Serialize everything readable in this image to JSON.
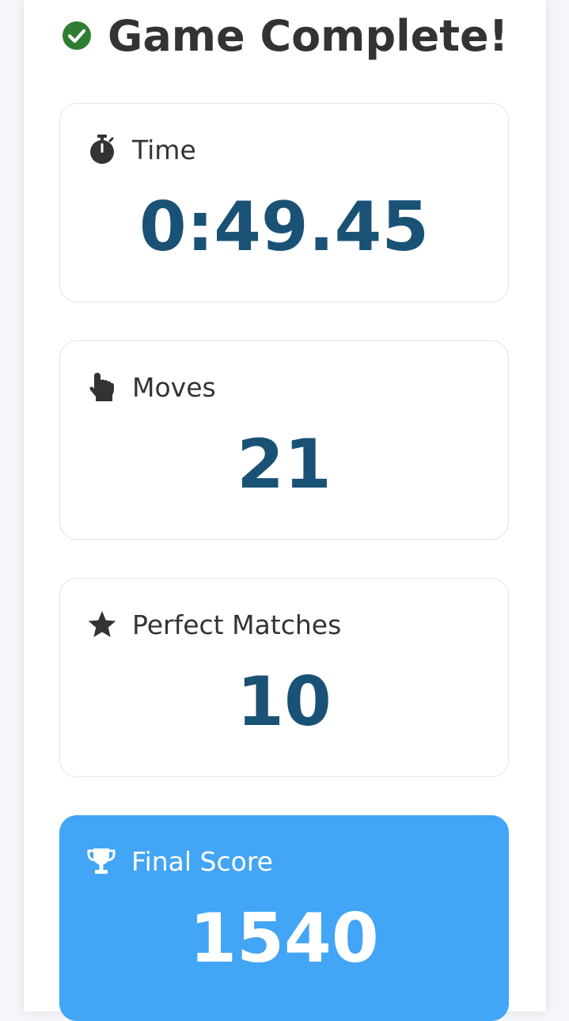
{
  "header": {
    "title": "Game Complete!",
    "icon": "check-circle-icon"
  },
  "stats": {
    "time": {
      "label": "Time",
      "value": "0:49.45",
      "icon": "stopwatch-icon"
    },
    "moves": {
      "label": "Moves",
      "value": "21",
      "icon": "pointer-hand-icon"
    },
    "perfect": {
      "label": "Perfect Matches",
      "value": "10",
      "icon": "star-icon"
    },
    "final": {
      "label": "Final Score",
      "value": "1540",
      "icon": "trophy-icon"
    }
  },
  "colors": {
    "check_green": "#2e7d32",
    "value_blue": "#1a5276",
    "final_card_bg": "#42a5f5",
    "label_dark": "#333333"
  }
}
